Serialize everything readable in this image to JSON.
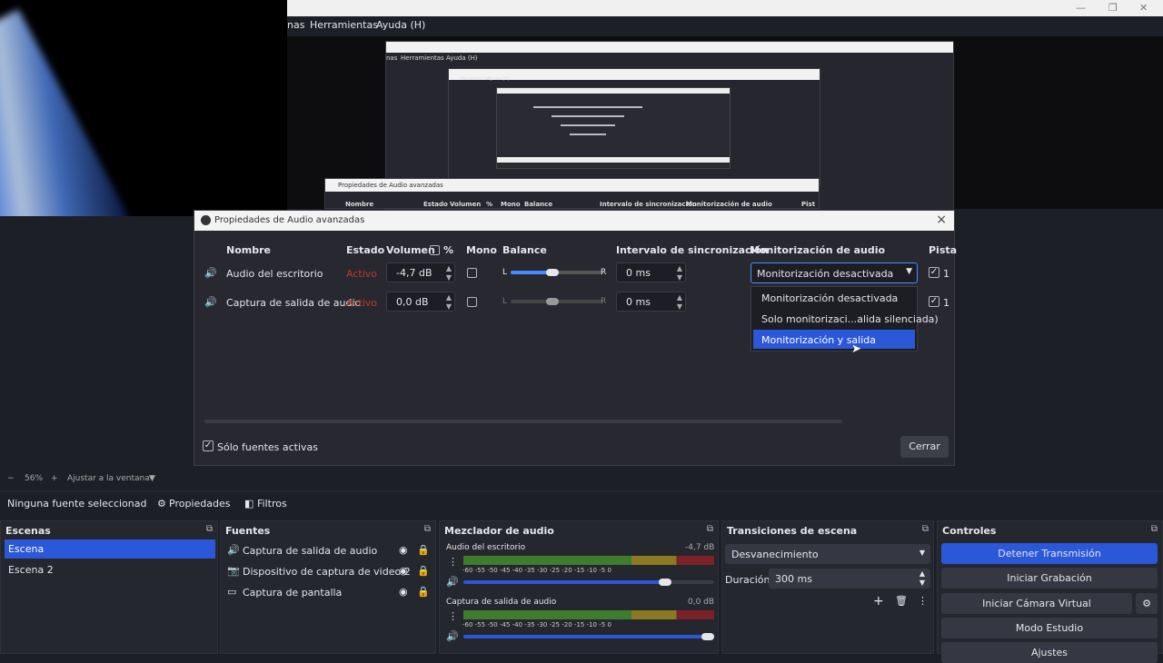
{
  "menubar": {
    "item_partial": "nas",
    "herramientas": "Herramientas",
    "ayuda": "Ayuda (H)"
  },
  "window_controls": {
    "minimize": "—",
    "restore": "❐",
    "close": "✕"
  },
  "nested": {
    "menu1_a": "nas",
    "menu1_b": "Herramientas",
    "menu1_c": "Ayuda (H)",
    "menu2_b": "Herramientas",
    "menu2_c": "Ayuda (H)",
    "dlg_title": "Propiedades de Audio avanzadas",
    "h_nombre": "Nombre",
    "h_estado": "Estado",
    "h_volumen": "Volumen",
    "h_pct": "%",
    "h_mono": "Mono",
    "h_balance": "Balance",
    "h_intervalo": "Intervalo de sincronización",
    "h_monitor": "Monitorización de audio",
    "h_pista": "Pist"
  },
  "dialog": {
    "title": "Propiedades de Audio avanzadas",
    "headers": {
      "nombre": "Nombre",
      "estado": "Estado",
      "volumen": "Volumen",
      "pct": "%",
      "mono": "Mono",
      "balance": "Balance",
      "intervalo": "Intervalo de sincronización",
      "monitor": "Monitorización de audio",
      "pistas": "Pista"
    },
    "rows": [
      {
        "name": "Audio del escritorio",
        "status": "Activo",
        "volume": "-4,7 dB",
        "balance_l": "L",
        "balance_r": "R",
        "balance": 0.5,
        "sync": "0 ms",
        "monitor": "Monitorización desactivada",
        "track": "1"
      },
      {
        "name": "Captura de salida de audio",
        "status": "Activo",
        "volume": "0,0 dB",
        "balance_l": "L",
        "balance_r": "R",
        "balance": 0.5,
        "sync": "0 ms",
        "track": "1"
      }
    ],
    "dropdown_options": [
      "Monitorización desactivada",
      "Solo monitorizaci...alida silenciada)",
      "Monitorización y salida"
    ],
    "only_active": "Sólo fuentes activas",
    "close_label": "Cerrar"
  },
  "zoom": {
    "minus": "−",
    "value": "56%",
    "plus": "+",
    "fit": "Ajustar a la ventana"
  },
  "source_bar": {
    "no_source": "Ninguna fuente seleccionad",
    "properties": "Propiedades",
    "filters": "Filtros"
  },
  "scenes": {
    "title": "Escenas",
    "items": [
      "Escena",
      "Escena 2"
    ]
  },
  "sources": {
    "title": "Fuentes",
    "items": [
      "Captura de salida de audio",
      "Dispositivo de captura de video 2",
      "Captura de pantalla"
    ]
  },
  "mixer": {
    "title": "Mezclador de audio",
    "channels": [
      {
        "name": "Audio del escritorio",
        "db": "-4,7 dB",
        "level": 0.83
      },
      {
        "name": "Captura de salida de audio",
        "db": "0,0 dB",
        "level": 1.0
      }
    ],
    "ticks": "-60  -55  -50  -45  -40  -35  -30  -25  -20  -15  -10   -5    0"
  },
  "transitions": {
    "title": "Transiciones de escena",
    "selected": "Desvanecimiento",
    "duration_label": "Duración",
    "duration_value": "300 ms"
  },
  "controls": {
    "title": "Controles",
    "stop_stream": "Detener Transmisión",
    "start_rec": "Iniciar Grabación",
    "virtual_cam": "Iniciar Cámara Virtual",
    "studio": "Modo Estudio",
    "settings": "Ajustes"
  },
  "colors": {
    "accent": "#2b57d9",
    "status_red": "#c0392b"
  }
}
